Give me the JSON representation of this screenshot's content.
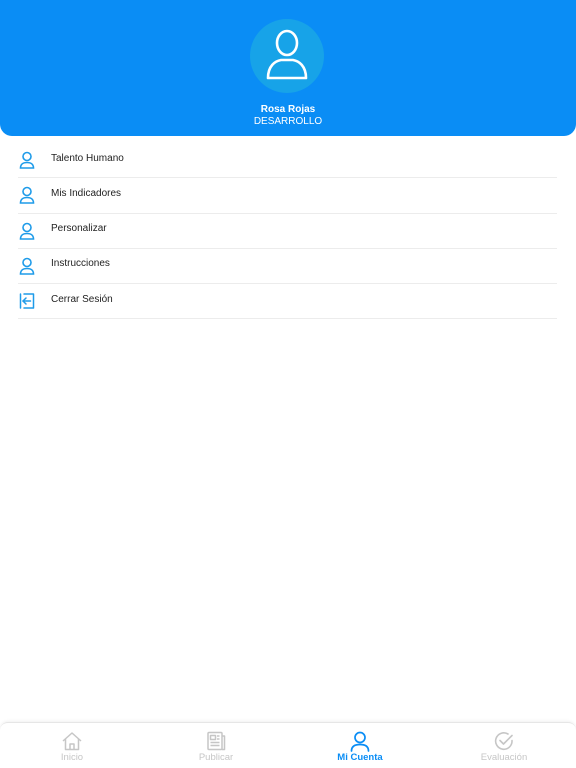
{
  "header": {
    "user_name": "Rosa Rojas",
    "department": "DESARROLLO",
    "avatar_icon": "user-avatar-icon"
  },
  "menu": {
    "items": [
      {
        "label": "Talento Humano",
        "icon": "user-icon"
      },
      {
        "label": "Mis Indicadores",
        "icon": "user-icon"
      },
      {
        "label": "Personalizar",
        "icon": "user-icon"
      },
      {
        "label": "Instrucciones",
        "icon": "user-icon"
      },
      {
        "label": "Cerrar Sesión",
        "icon": "logout-icon"
      }
    ]
  },
  "tabbar": {
    "tabs": [
      {
        "label": "Inicio",
        "icon": "home-icon",
        "active": false
      },
      {
        "label": "Publicar",
        "icon": "newspaper-icon",
        "active": false
      },
      {
        "label": "Mi Cuenta",
        "icon": "user-icon",
        "active": true
      },
      {
        "label": "Evaluación",
        "icon": "check-circle-icon",
        "active": false
      }
    ]
  },
  "colors": {
    "primary": "#0a8df5",
    "avatar_bg": "#17a3e8",
    "icon_blue": "#1e9be9",
    "inactive_gray": "#c6c6c6",
    "text_dark": "#222222"
  }
}
